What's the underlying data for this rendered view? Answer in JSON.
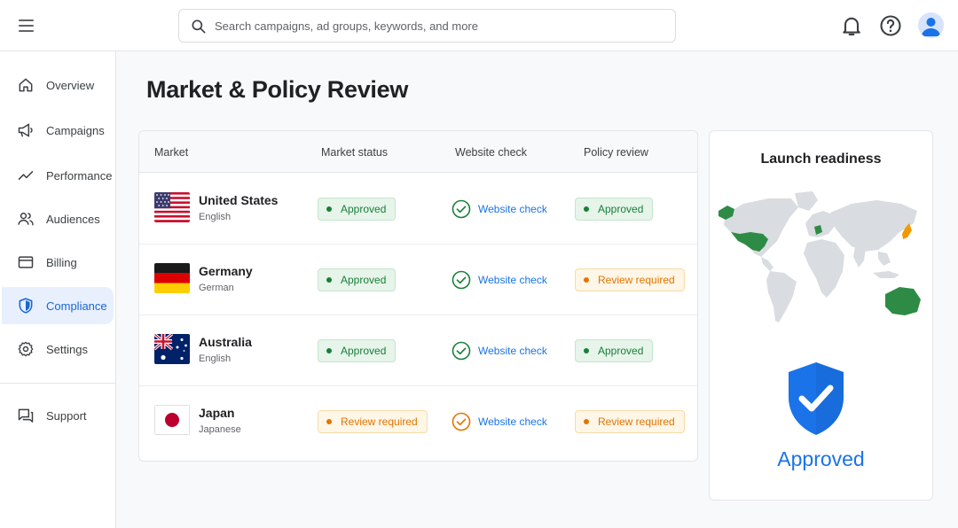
{
  "topbar": {
    "search_placeholder": "Search campaigns, ad groups, keywords, and more",
    "icons": [
      "menu-icon",
      "search-icon",
      "bell-icon",
      "help-icon",
      "account-icon"
    ]
  },
  "sidebar": {
    "items": [
      {
        "label": "Overview",
        "icon": "home-icon"
      },
      {
        "label": "Campaigns",
        "icon": "megaphone-icon"
      },
      {
        "label": "Performance",
        "icon": "trend-icon"
      },
      {
        "label": "Audiences",
        "icon": "people-icon"
      },
      {
        "label": "Billing",
        "icon": "card-icon"
      },
      {
        "label": "Compliance",
        "icon": "shield-icon",
        "active": true
      },
      {
        "label": "Settings",
        "icon": "gear-icon"
      },
      {
        "label": "Support",
        "icon": "chat-icon"
      }
    ]
  },
  "page": {
    "title": "Market & Policy Review"
  },
  "table": {
    "headers": [
      "Market",
      "Market status",
      "Website check",
      "Policy review"
    ],
    "rows": [
      {
        "market": "United States",
        "language": "English",
        "flag": "us-flag",
        "market_status": "Approved",
        "website_check": "Website check",
        "website_check_state": "passed",
        "policy_review": "Approved"
      },
      {
        "market": "Germany",
        "language": "German",
        "flag": "de-flag",
        "market_status": "Approved",
        "website_check": "Website check",
        "website_check_state": "passed",
        "policy_review": "Review required"
      },
      {
        "market": "Australia",
        "language": "English",
        "flag": "au-flag",
        "market_status": "Approved",
        "website_check": "Website check",
        "website_check_state": "passed",
        "policy_review": "Approved"
      },
      {
        "market": "Japan",
        "language": "Japanese",
        "flag": "jp-flag",
        "market_status": "Review required",
        "website_check": "Website check",
        "website_check_state": "warning",
        "policy_review": "Review required"
      }
    ]
  },
  "readiness": {
    "title": "Launch readiness",
    "status": "Approved",
    "map_highlights": [
      {
        "region": "United States",
        "color": "#2e8b45"
      },
      {
        "region": "Germany",
        "color": "#2e8b45"
      },
      {
        "region": "Australia",
        "color": "#2e8b45"
      },
      {
        "region": "Japan",
        "color": "#f29900"
      }
    ]
  },
  "colors": {
    "accent": "#1a73e8",
    "approved": "#188038",
    "review_required": "#e37400",
    "active_nav_bg": "#e8f0fe"
  }
}
